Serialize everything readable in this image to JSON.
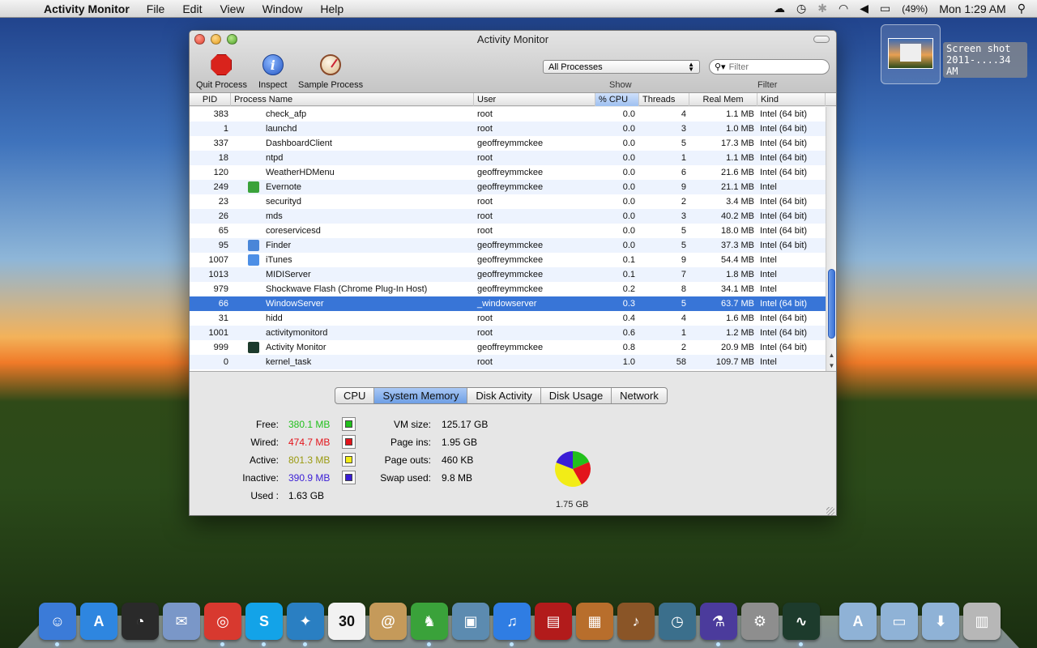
{
  "menubar": {
    "apple": "",
    "app_name": "Activity Monitor",
    "items": [
      "File",
      "Edit",
      "View",
      "Window",
      "Help"
    ],
    "battery": "(49%)",
    "clock": "Mon 1:29 AM"
  },
  "screenshot_label": {
    "line1": "Screen shot",
    "line2": "2011-....34 AM"
  },
  "window": {
    "title": "Activity Monitor",
    "toolbar": {
      "quit": "Quit Process",
      "inspect": "Inspect",
      "sample": "Sample Process",
      "inspect_glyph": "i"
    },
    "show_select": "All Processes",
    "show_label": "Show",
    "filter_placeholder": "Filter",
    "filter_label": "Filter",
    "columns": {
      "pid": "PID",
      "name": "Process Name",
      "user": "User",
      "cpu": "% CPU",
      "threads": "Threads",
      "mem": "Real Mem",
      "kind": "Kind"
    },
    "processes": [
      {
        "pid": "383",
        "name": "check_afp",
        "user": "root",
        "cpu": "0.0",
        "threads": "4",
        "mem": "1.1 MB",
        "kind": "Intel (64 bit)",
        "icon": ""
      },
      {
        "pid": "1",
        "name": "launchd",
        "user": "root",
        "cpu": "0.0",
        "threads": "3",
        "mem": "1.0 MB",
        "kind": "Intel (64 bit)",
        "icon": ""
      },
      {
        "pid": "337",
        "name": "DashboardClient",
        "user": "geoffreymmckee",
        "cpu": "0.0",
        "threads": "5",
        "mem": "17.3 MB",
        "kind": "Intel (64 bit)",
        "icon": ""
      },
      {
        "pid": "18",
        "name": "ntpd",
        "user": "root",
        "cpu": "0.0",
        "threads": "1",
        "mem": "1.1 MB",
        "kind": "Intel (64 bit)",
        "icon": ""
      },
      {
        "pid": "120",
        "name": "WeatherHDMenu",
        "user": "geoffreymmckee",
        "cpu": "0.0",
        "threads": "6",
        "mem": "21.6 MB",
        "kind": "Intel (64 bit)",
        "icon": ""
      },
      {
        "pid": "249",
        "name": "Evernote",
        "user": "geoffreymmckee",
        "cpu": "0.0",
        "threads": "9",
        "mem": "21.1 MB",
        "kind": "Intel",
        "icon": "evernote-icon"
      },
      {
        "pid": "23",
        "name": "securityd",
        "user": "root",
        "cpu": "0.0",
        "threads": "2",
        "mem": "3.4 MB",
        "kind": "Intel (64 bit)",
        "icon": ""
      },
      {
        "pid": "26",
        "name": "mds",
        "user": "root",
        "cpu": "0.0",
        "threads": "3",
        "mem": "40.2 MB",
        "kind": "Intel (64 bit)",
        "icon": ""
      },
      {
        "pid": "65",
        "name": "coreservicesd",
        "user": "root",
        "cpu": "0.0",
        "threads": "5",
        "mem": "18.0 MB",
        "kind": "Intel (64 bit)",
        "icon": ""
      },
      {
        "pid": "95",
        "name": "Finder",
        "user": "geoffreymmckee",
        "cpu": "0.0",
        "threads": "5",
        "mem": "37.3 MB",
        "kind": "Intel (64 bit)",
        "icon": "finder-icon"
      },
      {
        "pid": "1007",
        "name": "iTunes",
        "user": "geoffreymmckee",
        "cpu": "0.1",
        "threads": "9",
        "mem": "54.4 MB",
        "kind": "Intel",
        "icon": "itunes-icon"
      },
      {
        "pid": "1013",
        "name": "MIDIServer",
        "user": "geoffreymmckee",
        "cpu": "0.1",
        "threads": "7",
        "mem": "1.8 MB",
        "kind": "Intel",
        "icon": ""
      },
      {
        "pid": "979",
        "name": "Shockwave Flash (Chrome Plug-In Host)",
        "user": "geoffreymmckee",
        "cpu": "0.2",
        "threads": "8",
        "mem": "34.1 MB",
        "kind": "Intel",
        "icon": ""
      },
      {
        "pid": "66",
        "name": "WindowServer",
        "user": "_windowserver",
        "cpu": "0.3",
        "threads": "5",
        "mem": "63.7 MB",
        "kind": "Intel (64 bit)",
        "icon": "",
        "selected": true
      },
      {
        "pid": "31",
        "name": "hidd",
        "user": "root",
        "cpu": "0.4",
        "threads": "4",
        "mem": "1.6 MB",
        "kind": "Intel (64 bit)",
        "icon": ""
      },
      {
        "pid": "1001",
        "name": "activitymonitord",
        "user": "root",
        "cpu": "0.6",
        "threads": "1",
        "mem": "1.2 MB",
        "kind": "Intel (64 bit)",
        "icon": ""
      },
      {
        "pid": "999",
        "name": "Activity Monitor",
        "user": "geoffreymmckee",
        "cpu": "0.8",
        "threads": "2",
        "mem": "20.9 MB",
        "kind": "Intel (64 bit)",
        "icon": "activity-monitor-icon"
      },
      {
        "pid": "0",
        "name": "kernel_task",
        "user": "root",
        "cpu": "1.0",
        "threads": "58",
        "mem": "109.7 MB",
        "kind": "Intel",
        "icon": ""
      }
    ],
    "tabs": [
      "CPU",
      "System Memory",
      "Disk Activity",
      "Disk Usage",
      "Network"
    ],
    "active_tab": "System Memory",
    "memory": {
      "free_label": "Free:",
      "free": "380.1 MB",
      "free_color": "#22c01c",
      "wired_label": "Wired:",
      "wired": "474.7 MB",
      "wired_color": "#e3141b",
      "active_label": "Active:",
      "active": "801.3 MB",
      "active_color": "#f2ec17",
      "inactive_label": "Inactive:",
      "inactive": "390.9 MB",
      "inactive_color": "#3a1ed6",
      "used_label": "Used :",
      "used": "1.63 GB",
      "vm_label": "VM size:",
      "vm": "125.17 GB",
      "pageins_label": "Page ins:",
      "pageins": "1.95 GB",
      "pageouts_label": "Page outs:",
      "pageouts": "460 KB",
      "swap_label": "Swap used:",
      "swap": "9.8 MB",
      "total": "1.75 GB"
    }
  },
  "dock": [
    {
      "name": "finder",
      "color": "#3b7bd8",
      "glyph": "☺"
    },
    {
      "name": "app-store",
      "color": "#2e86e0",
      "glyph": "A"
    },
    {
      "name": "dashboard",
      "color": "#2a2a2a",
      "glyph": "◔"
    },
    {
      "name": "mail",
      "color": "#7a97c8",
      "glyph": "✉"
    },
    {
      "name": "chrome",
      "color": "#d8392f",
      "glyph": "◎"
    },
    {
      "name": "skype",
      "color": "#13a3e8",
      "glyph": "S"
    },
    {
      "name": "twitter",
      "color": "#2a7fc2",
      "glyph": "✦"
    },
    {
      "name": "ical",
      "color": "#f2f2f2",
      "glyph": "30"
    },
    {
      "name": "address-book",
      "color": "#c59a5a",
      "glyph": "@"
    },
    {
      "name": "evernote",
      "color": "#3aa23a",
      "glyph": "♞"
    },
    {
      "name": "iphoto",
      "color": "#5c8bb0",
      "glyph": "▣"
    },
    {
      "name": "itunes",
      "color": "#2f7de3",
      "glyph": "♫"
    },
    {
      "name": "photo-booth",
      "color": "#b21b1b",
      "glyph": "▤"
    },
    {
      "name": "image-capture",
      "color": "#b86e2c",
      "glyph": "▦"
    },
    {
      "name": "garageband",
      "color": "#8a5527",
      "glyph": "♪"
    },
    {
      "name": "time-machine",
      "color": "#3b6f8c",
      "glyph": "◷"
    },
    {
      "name": "instruments",
      "color": "#4b3b9c",
      "glyph": "⚗"
    },
    {
      "name": "system-preferences",
      "color": "#8e8e8e",
      "glyph": "⚙"
    },
    {
      "name": "activity-monitor",
      "color": "#1d3b2c",
      "glyph": "∿"
    },
    {
      "name": "applications-folder",
      "color": "#8fb2d6",
      "glyph": "A"
    },
    {
      "name": "documents-folder",
      "color": "#8fb2d6",
      "glyph": "▭"
    },
    {
      "name": "downloads-folder",
      "color": "#8fb2d6",
      "glyph": "⬇"
    },
    {
      "name": "trash",
      "color": "#b7b7b7",
      "glyph": "▥"
    }
  ]
}
